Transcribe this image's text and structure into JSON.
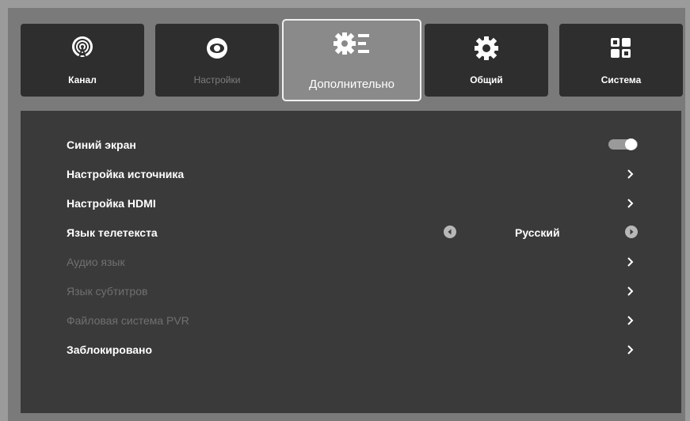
{
  "tabs": [
    {
      "label": "Канал",
      "icon": "antenna-icon",
      "state": "normal"
    },
    {
      "label": "Настройки",
      "icon": "eye-icon",
      "state": "disabled"
    },
    {
      "label": "Дополнительно",
      "icon": "gear-list-icon",
      "state": "selected"
    },
    {
      "label": "Общий",
      "icon": "gear-icon",
      "state": "normal"
    },
    {
      "label": "Система",
      "icon": "grid-icon",
      "state": "normal"
    }
  ],
  "menu": {
    "blue_screen": {
      "label": "Синий экран",
      "enabled": true,
      "toggle_on": true
    },
    "source_setup": {
      "label": "Настройка источника",
      "enabled": true
    },
    "hdmi_setup": {
      "label": "Настройка HDMI",
      "enabled": true
    },
    "teletext_language": {
      "label": "Язык телетекста",
      "enabled": true,
      "value": "Русский"
    },
    "audio_language": {
      "label": "Аудио язык",
      "enabled": false
    },
    "subtitle_language": {
      "label": "Язык субтитров",
      "enabled": false
    },
    "pvr_file_system": {
      "label": "Файловая система PVR",
      "enabled": false
    },
    "locked": {
      "label": "Заблокировано",
      "enabled": true
    }
  },
  "colors": {
    "background": "#7a7a7a",
    "panel": "#3a3a3a",
    "tab": "#2e2e2e",
    "active_tab": "#8a8a8a",
    "text": "#ffffff",
    "disabled_text": "#707070"
  }
}
